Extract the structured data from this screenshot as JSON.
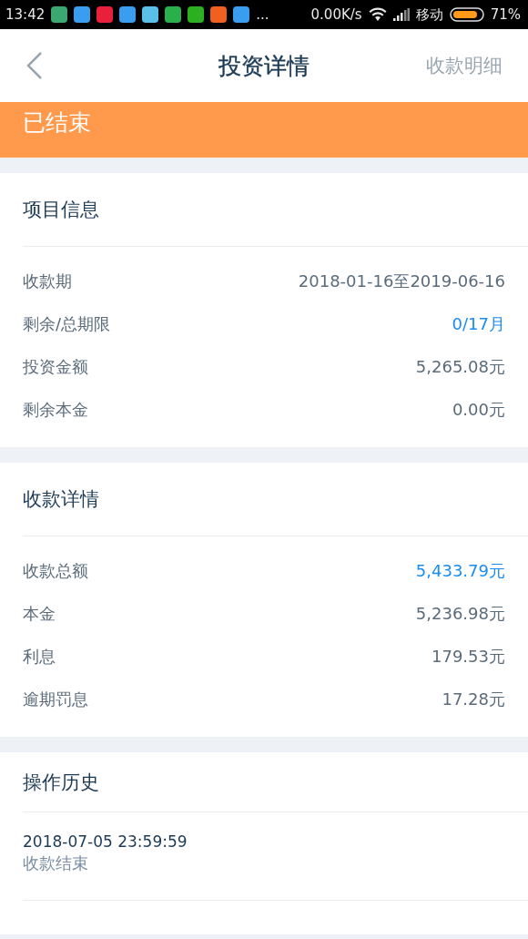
{
  "status_bar": {
    "time": "13:42",
    "notifications": [
      {
        "color": "#3aa870"
      },
      {
        "color": "#3a9ef0"
      },
      {
        "color": "#e8203a"
      },
      {
        "color": "#3a9ef0"
      },
      {
        "color": "#5bc0e8"
      },
      {
        "color": "#2ab04a"
      },
      {
        "color": "#2ab020"
      },
      {
        "color": "#f06020"
      },
      {
        "color": "#3a9ef0"
      }
    ],
    "more": "...",
    "speed": "0.00K/s",
    "carrier": "移动",
    "battery": "71%"
  },
  "nav": {
    "title": "投资详情",
    "action": "收款明细"
  },
  "banner": {
    "status": "已结束"
  },
  "sections": [
    {
      "title": "项目信息",
      "rows": [
        {
          "label": "收款期",
          "value": "2018-01-16至2019-06-16",
          "highlight": false
        },
        {
          "label": "剩余/总期限",
          "value": "0/17月",
          "highlight": true
        },
        {
          "label": "投资金额",
          "value": "5,265.08元",
          "highlight": false
        },
        {
          "label": "剩余本金",
          "value": "0.00元",
          "highlight": false
        }
      ]
    },
    {
      "title": "收款详情",
      "rows": [
        {
          "label": "收款总额",
          "value": "5,433.79元",
          "highlight": true
        },
        {
          "label": "本金",
          "value": "5,236.98元",
          "highlight": false
        },
        {
          "label": "利息",
          "value": "179.53元",
          "highlight": false
        },
        {
          "label": "逾期罚息",
          "value": "17.28元",
          "highlight": false
        }
      ]
    }
  ],
  "history": {
    "title": "操作历史",
    "entries": [
      {
        "time": "2018-07-05 23:59:59",
        "event": "收款结束"
      }
    ]
  }
}
